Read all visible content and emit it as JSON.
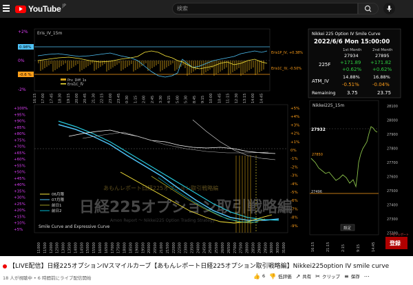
{
  "app": {
    "name": "YouTube",
    "region": "JP"
  },
  "header": {
    "search_placeholder": "検索"
  },
  "video_title": "【LIVE配信】日経225オプションIVスマイルカーブ【あもんレポート日経225オプション取引戦略編】Nikkei225option IV smile curve",
  "meta": "18 人が視聴中 • 6 時間前にライブ配信開始",
  "actions": {
    "like_count": "6",
    "dislike": "低評価",
    "share": "共有",
    "clip": "クリップ",
    "save": "保存"
  },
  "overlay": {
    "iv_chart_label": "Eris_IV_15m",
    "iv_axis": [
      "+2%",
      "0%",
      "-2%"
    ],
    "iv_tag_top": "0.98%",
    "iv_tag_bottom": "-0.6 %",
    "iv_right_top": "Eris1P_IV, +0.38%",
    "iv_right_bottom": "Eris1C_IV, -0.50%",
    "legend": [
      "Prv_Diff_1s",
      "Eris1C_IV"
    ],
    "time_ticks": [
      "16:15",
      "17:00",
      "17:45",
      "18:30",
      "19:15",
      "20:00",
      "20:45",
      "21:30",
      "22:15",
      "23:00",
      "23:45",
      "0:30",
      "1:15",
      "2:00",
      "2:45",
      "3:30",
      "4:15",
      "5:00",
      "5:30",
      "8:45",
      "9:15",
      "10:00",
      "10:45",
      "11:15",
      "12:30",
      "13:15",
      "14:00",
      "14:45"
    ],
    "smile_left_axis": [
      "+100%",
      "+95%",
      "+90%",
      "+85%",
      "+80%",
      "+75%",
      "+70%",
      "+65%",
      "+60%",
      "+55%",
      "+50%",
      "+45%",
      "+40%",
      "+35%",
      "+30%",
      "+25%",
      "+20%",
      "+15%",
      "+10%",
      "+5%"
    ],
    "smile_right_axis": [
      "+5%",
      "+4%",
      "+3%",
      "+2%",
      "+1%",
      "0%",
      "-1%",
      "-2%",
      "-3%",
      "-4%",
      "-5%",
      "-6%",
      "-7%",
      "-8%",
      "-9%"
    ],
    "strikes": [
      "11000",
      "11500",
      "12000",
      "12500",
      "13000",
      "13500",
      "14000",
      "14500",
      "15000",
      "15500",
      "16000",
      "16500",
      "17000",
      "17500",
      "18000",
      "18500",
      "19000",
      "19500",
      "20000",
      "20500",
      "21000",
      "21500",
      "22000",
      "22500",
      "23000",
      "23500",
      "24000",
      "24500",
      "25000",
      "25500",
      "26000",
      "26500",
      "27000",
      "27500",
      "28000",
      "28500",
      "29000",
      "29500",
      "30000",
      "30500",
      "31000"
    ],
    "smile_legend": [
      "06月限",
      "07月限",
      "前日1",
      "前日2"
    ],
    "smile_label": "Smile Curve and Expressive Curve",
    "watermark_line1": "あもんレポート日経225オプション取引戦略編",
    "watermark_line2": "日経225オプション取引戦略編",
    "watermark_line3": "Amon Report ～ Nikkei225 Option Trading Strategy",
    "info_title": "Nikkei 225 Option IV Smile Curve",
    "info_datetime": "2022/6/6 Mon 15:00:00",
    "info_col1": "1st Month",
    "info_col2": "2nd Month",
    "row_225f": {
      "label": "225F",
      "v1": "27934",
      "v2": "27895",
      "c1": "+171.89",
      "c2": "+171.82",
      "p1": "+0.62%",
      "p2": "+0.62%"
    },
    "row_atm": {
      "label": "ATM_IV",
      "v1": "14.88%",
      "v2": "16.88%",
      "c1": "-0.51%",
      "c2": "-0.04%"
    },
    "row_remaining": {
      "label": "Remaining",
      "v1": "3.75",
      "v2": "23.75"
    },
    "n225_label": "Nikkei225_15m",
    "n225_axis": [
      "28100",
      "28000",
      "27900",
      "27800",
      "27700",
      "27600",
      "27500",
      "27400",
      "27300",
      "27200"
    ],
    "n225_last": "27932",
    "n225_ref": "27496",
    "n225_high": "27850",
    "n225_button": "設定",
    "n225_times": [
      "16:15",
      "21:15",
      "2:15",
      "9:15",
      "14:45"
    ],
    "brand_badge": "登録",
    "brand_small": "アモンレポート"
  },
  "colors": {
    "youtube_red": "#ff0000",
    "up_green": "#2ecc40",
    "down_orange": "#ff9f1a",
    "cyan": "#4fc3f7",
    "bar_orange": "#d4a017"
  }
}
